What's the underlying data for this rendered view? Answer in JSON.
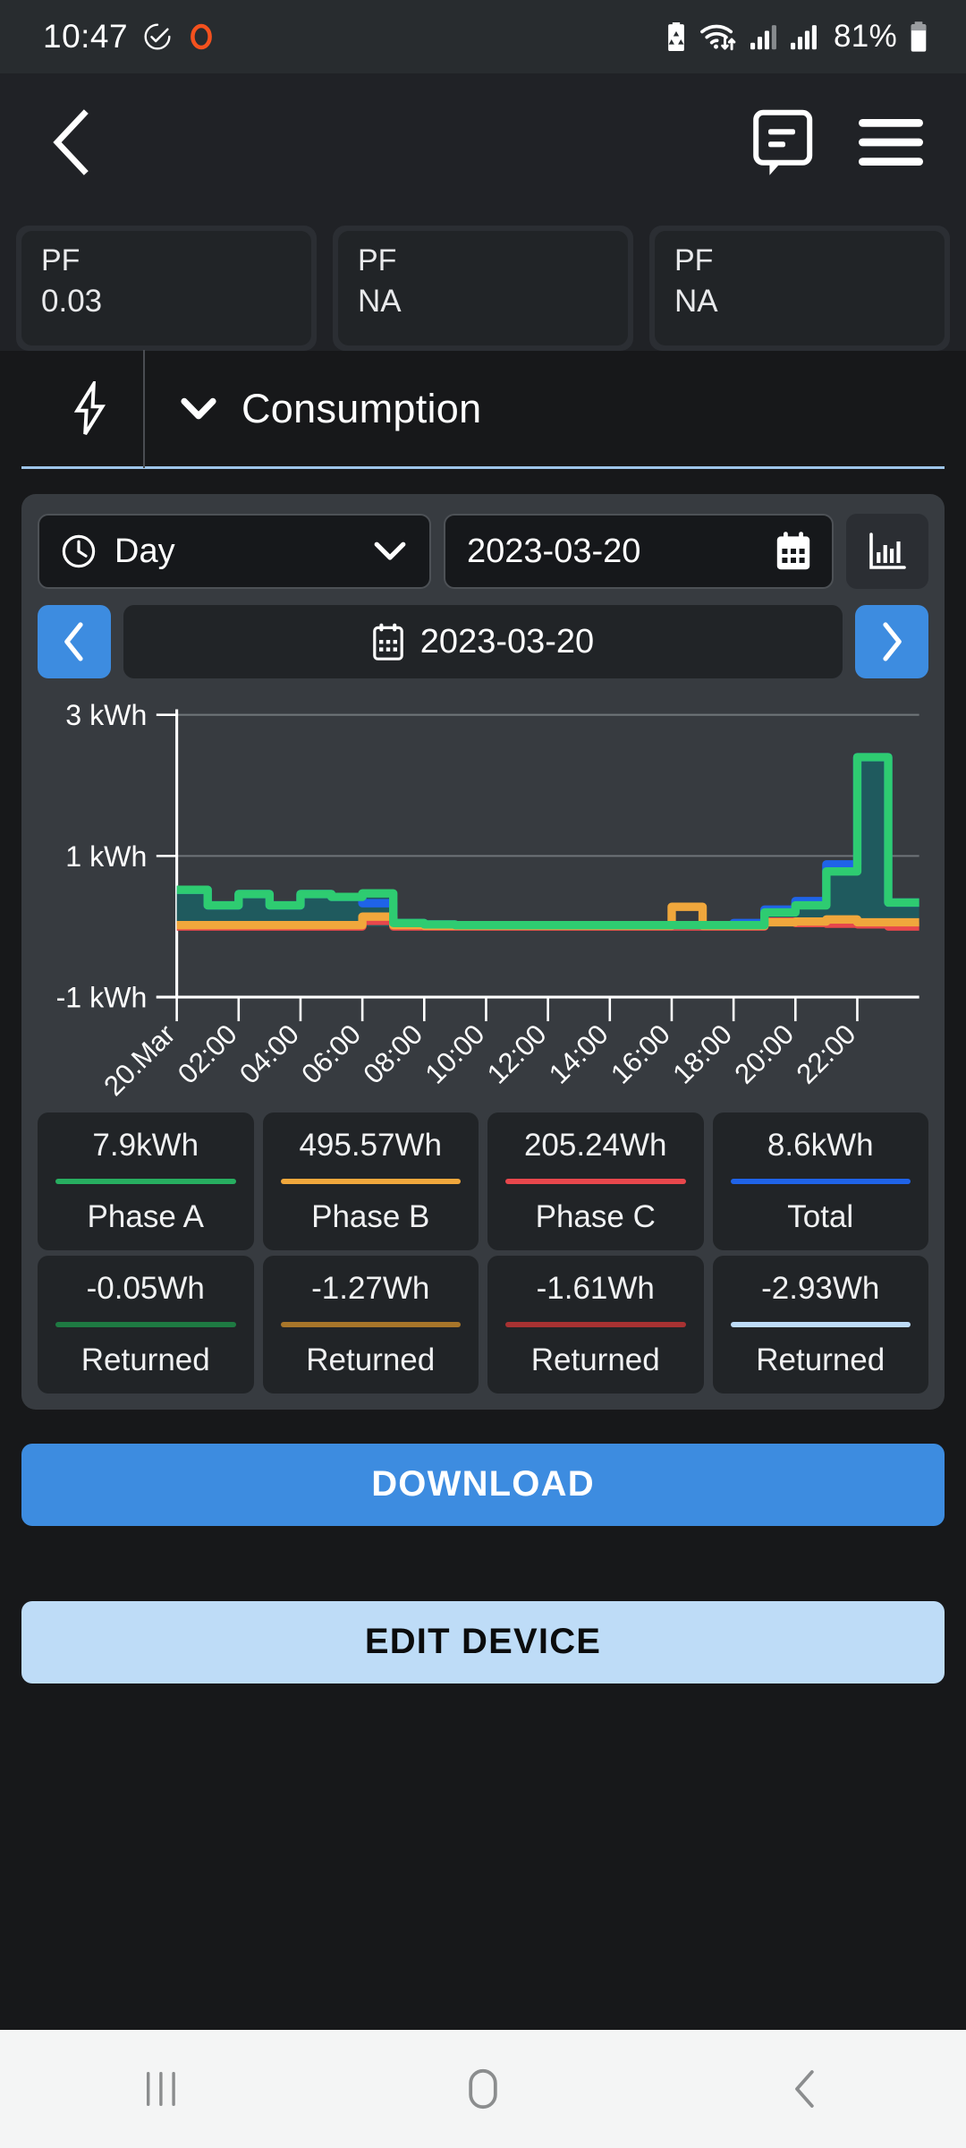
{
  "status_bar": {
    "time": "10:47",
    "battery_percent": "81%",
    "icons": [
      "check-circle-icon",
      "orange-ring-icon",
      "battery-saver-icon",
      "wifi-icon",
      "signal-1-icon",
      "signal-2-icon",
      "battery-icon"
    ]
  },
  "app_bar": {
    "back_icon": "back-chevron-icon",
    "message_icon": "message-bubble-icon",
    "menu_icon": "hamburger-menu-icon"
  },
  "pf_cards": [
    {
      "label": "PF",
      "value": "0.03"
    },
    {
      "label": "PF",
      "value": "NA"
    },
    {
      "label": "PF",
      "value": "NA"
    }
  ],
  "section": {
    "bolt_icon": "lightning-bolt-icon",
    "chevron_icon": "chevron-down-icon",
    "title": "Consumption"
  },
  "controls": {
    "period_icon": "clock-icon",
    "period_value": "Day",
    "period_chevron": "chevron-down-icon",
    "date_value": "2023-03-20",
    "date_icon": "calendar-icon",
    "chart_type_icon": "bar-chart-icon",
    "prev_icon": "chevron-left-icon",
    "next_icon": "chevron-right-icon",
    "nav_date_icon": "calendar-icon",
    "nav_date_value": "2023-03-20"
  },
  "stats": [
    {
      "value": "7.9kWh",
      "label": "Phase A",
      "color": "#27ae60"
    },
    {
      "value": "495.57Wh",
      "label": "Phase B",
      "color": "#f0a73c"
    },
    {
      "value": "205.24Wh",
      "label": "Phase C",
      "color": "#e8474c"
    },
    {
      "value": "8.6kWh",
      "label": "Total",
      "color": "#1f63e8"
    }
  ],
  "returned": [
    {
      "value": "-0.05Wh",
      "label": "Returned",
      "color": "#1e7a42"
    },
    {
      "value": "-1.27Wh",
      "label": "Returned",
      "color": "#a8762a"
    },
    {
      "value": "-1.61Wh",
      "label": "Returned",
      "color": "#a83232"
    },
    {
      "value": "-2.93Wh",
      "label": "Returned",
      "color": "#bedcf7"
    }
  ],
  "buttons": {
    "download": "DOWNLOAD",
    "edit_device": "EDIT DEVICE"
  },
  "nav_bar": {
    "recents_icon": "recents-icon",
    "home_icon": "home-icon",
    "back_icon": "back-chevron-icon"
  },
  "chart_data": {
    "type": "area",
    "title": "Consumption",
    "xlabel": "",
    "ylabel": "kWh",
    "ylim": [
      -1,
      3
    ],
    "yticks": [
      3,
      1,
      -1
    ],
    "ytick_labels": [
      "3 kWh",
      "1 kWh",
      "-1 kWh"
    ],
    "grid": true,
    "legend_position": "below-as-cards",
    "x": [
      "20.Mar",
      "01:00",
      "02:00",
      "03:00",
      "04:00",
      "05:00",
      "06:00",
      "07:00",
      "08:00",
      "09:00",
      "10:00",
      "11:00",
      "12:00",
      "13:00",
      "14:00",
      "15:00",
      "16:00",
      "17:00",
      "18:00",
      "19:00",
      "20:00",
      "21:00",
      "22:00",
      "23:00"
    ],
    "xtick_labels": [
      "20.Mar",
      "02:00",
      "04:00",
      "06:00",
      "08:00",
      "10:00",
      "12:00",
      "14:00",
      "16:00",
      "18:00",
      "20:00",
      "22:00"
    ],
    "series": [
      {
        "name": "Phase A",
        "color": "#2ecc71",
        "fill": "#1f5a5e",
        "values": [
          0.52,
          0.3,
          0.46,
          0.3,
          0.46,
          0.42,
          0.47,
          0.05,
          0.03,
          0.02,
          0.02,
          0.02,
          0.02,
          0.02,
          0.02,
          0.02,
          0.02,
          0.02,
          0.02,
          0.2,
          0.3,
          0.78,
          2.4,
          0.34
        ]
      },
      {
        "name": "Phase B",
        "color": "#f0a73c",
        "values": [
          0.02,
          0.02,
          0.02,
          0.02,
          0.02,
          0.02,
          0.14,
          0.02,
          0.01,
          0.01,
          0.01,
          0.01,
          0.01,
          0.01,
          0.01,
          0.01,
          0.28,
          0.01,
          0.01,
          0.06,
          0.07,
          0.1,
          0.06,
          0.06
        ]
      },
      {
        "name": "Phase C",
        "color": "#e8474c",
        "values": [
          0.0,
          0.0,
          0.0,
          0.0,
          0.0,
          0.0,
          0.08,
          0.0,
          0.0,
          0.0,
          0.0,
          0.0,
          0.0,
          0.0,
          0.0,
          0.0,
          0.0,
          0.0,
          0.0,
          0.07,
          0.05,
          0.04,
          0.03,
          0.0
        ]
      },
      {
        "name": "Total",
        "color": "#1f63e8",
        "values": [
          0.52,
          0.3,
          0.46,
          0.3,
          0.46,
          0.42,
          0.33,
          0.05,
          0.03,
          0.02,
          0.02,
          0.02,
          0.02,
          0.02,
          0.02,
          0.02,
          0.02,
          0.02,
          0.05,
          0.24,
          0.36,
          0.88,
          2.4,
          0.34
        ]
      }
    ]
  }
}
